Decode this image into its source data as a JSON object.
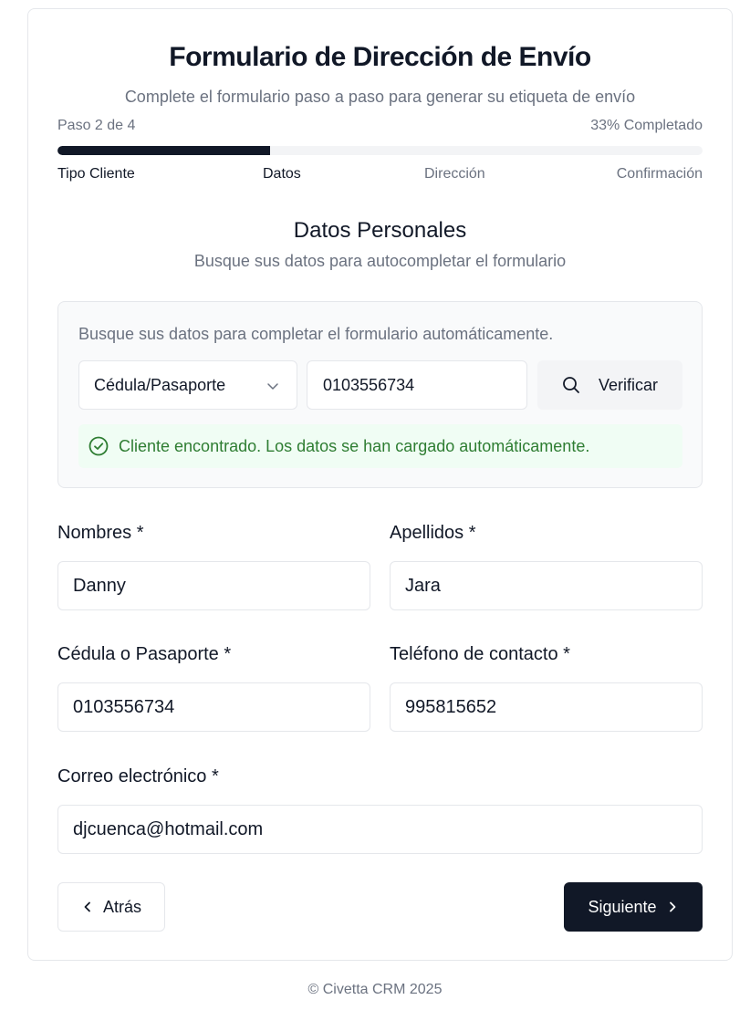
{
  "header": {
    "title": "Formulario de Dirección de Envío",
    "subtitle": "Complete el formulario paso a paso para generar su etiqueta de envío"
  },
  "progress": {
    "step_text": "Paso 2 de 4",
    "percent_text": "33% Completado",
    "percent": 33,
    "steps": [
      {
        "label": "Tipo Cliente",
        "status": "done"
      },
      {
        "label": "Datos",
        "status": "current"
      },
      {
        "label": "Dirección",
        "status": "pending"
      },
      {
        "label": "Confirmación",
        "status": "pending"
      }
    ]
  },
  "section": {
    "title": "Datos Personales",
    "subtitle": "Busque sus datos para autocompletar el formulario"
  },
  "lookup": {
    "hint": "Busque sus datos para completar el formulario automáticamente.",
    "doc_type": "Cédula/Pasaporte",
    "doc_number": "0103556734",
    "verify_label": "Verificar",
    "success_message": "Cliente encontrado. Los datos se han cargado automáticamente."
  },
  "form": {
    "nombres_label": "Nombres *",
    "nombres_value": "Danny",
    "apellidos_label": "Apellidos *",
    "apellidos_value": "Jara",
    "cedula_label": "Cédula o Pasaporte *",
    "cedula_value": "0103556734",
    "telefono_label": "Teléfono de contacto *",
    "telefono_value": "995815652",
    "correo_label": "Correo electrónico *",
    "correo_value": "djcuenca@hotmail.com"
  },
  "nav": {
    "back_label": "Atrás",
    "next_label": "Siguiente"
  },
  "footer": {
    "text": "© Civetta CRM 2025"
  },
  "colors": {
    "primary": "#111827",
    "muted": "#6b7280",
    "success_text": "#2e7d32",
    "success_bg": "#f0fdf4"
  },
  "icons": [
    "chevron-down-icon",
    "search-icon",
    "check-circle-icon",
    "chevron-left-icon",
    "chevron-right-icon"
  ]
}
